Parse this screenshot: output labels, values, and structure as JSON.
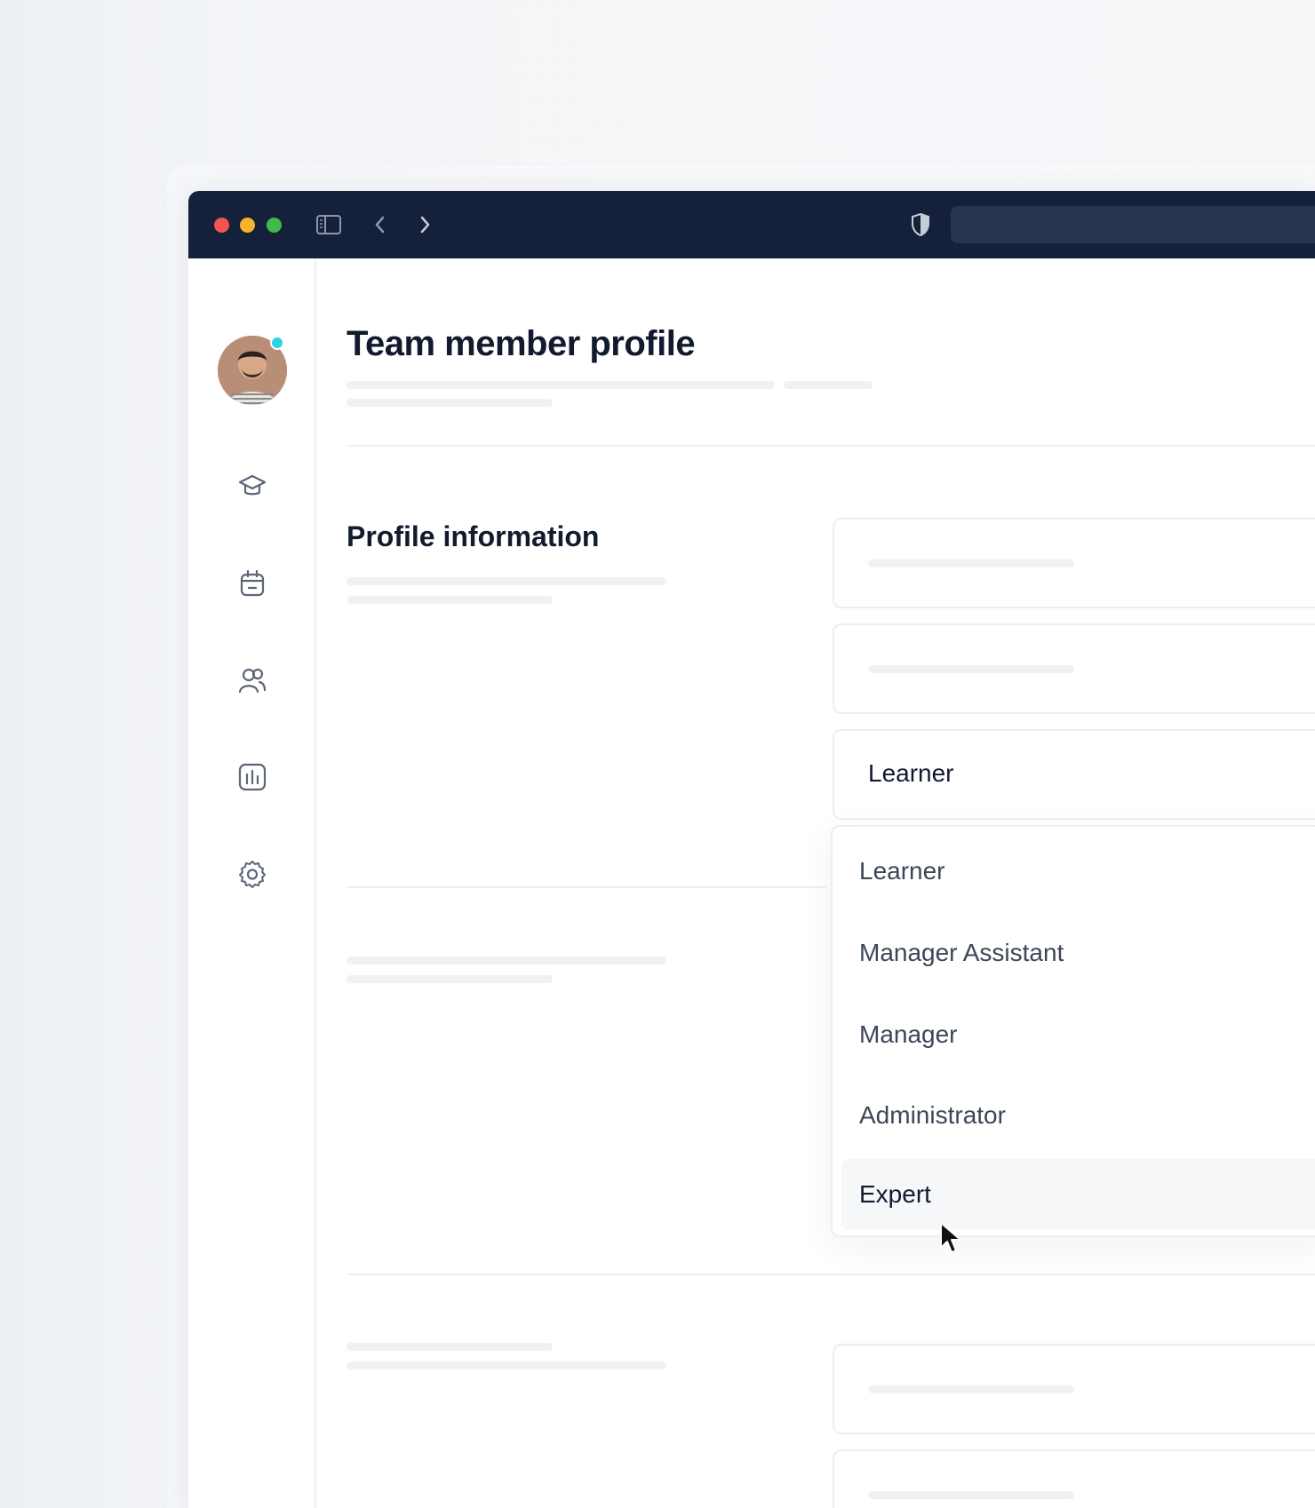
{
  "window": {
    "controls": [
      "close",
      "minimize",
      "maximize"
    ],
    "toolbar_icons": [
      "sidebar-toggle-icon",
      "chevron-left-icon",
      "chevron-right-icon",
      "shield-icon"
    ]
  },
  "sidebar": {
    "user": {
      "status": "online",
      "status_color": "#2fd0e6"
    },
    "items": [
      {
        "icon": "graduation-cap-icon"
      },
      {
        "icon": "calendar-icon"
      },
      {
        "icon": "users-icon"
      },
      {
        "icon": "chart-icon"
      },
      {
        "icon": "gear-icon"
      }
    ]
  },
  "page": {
    "title": "Team member profile"
  },
  "profile": {
    "section_title": "Profile information",
    "role_select": {
      "selected": "Learner",
      "options": [
        "Learner",
        "Manager Assistant",
        "Manager",
        "Administrator",
        "Expert"
      ],
      "highlighted": "Expert"
    }
  },
  "colors": {
    "titlebar": "#15213a",
    "urlbar": "#27354f",
    "text_primary": "#121a2e",
    "accent_presence": "#2fd0e6"
  }
}
